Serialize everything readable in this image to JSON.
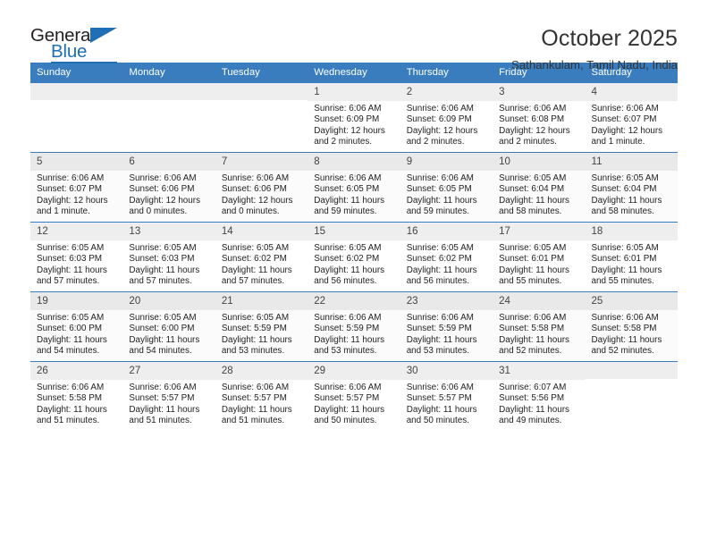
{
  "brand": {
    "name_part1": "General",
    "name_part2": "Blue"
  },
  "header": {
    "title": "October 2025",
    "location": "Sathankulam, Tamil Nadu, India"
  },
  "theme": {
    "accent": "#3a7dbf",
    "logo_blue": "#1f6fb4",
    "daynum_bg": "#eeeeee",
    "alt_row_bg": "#fbfbfb"
  },
  "weekday_headers": [
    "Sunday",
    "Monday",
    "Tuesday",
    "Wednesday",
    "Thursday",
    "Friday",
    "Saturday"
  ],
  "labels": {
    "sunrise_prefix": "Sunrise:",
    "sunset_prefix": "Sunset:",
    "daylight_prefix": "Daylight:"
  },
  "weeks": [
    [
      {
        "day": "",
        "empty": true,
        "line1": "",
        "line2": "",
        "line3": "",
        "line4": ""
      },
      {
        "day": "",
        "empty": true,
        "line1": "",
        "line2": "",
        "line3": "",
        "line4": ""
      },
      {
        "day": "",
        "empty": true,
        "line1": "",
        "line2": "",
        "line3": "",
        "line4": ""
      },
      {
        "day": "1",
        "empty": false,
        "line1": "Sunrise: 6:06 AM",
        "line2": "Sunset: 6:09 PM",
        "line3": "Daylight: 12 hours",
        "line4": "and 2 minutes."
      },
      {
        "day": "2",
        "empty": false,
        "line1": "Sunrise: 6:06 AM",
        "line2": "Sunset: 6:09 PM",
        "line3": "Daylight: 12 hours",
        "line4": "and 2 minutes."
      },
      {
        "day": "3",
        "empty": false,
        "line1": "Sunrise: 6:06 AM",
        "line2": "Sunset: 6:08 PM",
        "line3": "Daylight: 12 hours",
        "line4": "and 2 minutes."
      },
      {
        "day": "4",
        "empty": false,
        "line1": "Sunrise: 6:06 AM",
        "line2": "Sunset: 6:07 PM",
        "line3": "Daylight: 12 hours",
        "line4": "and 1 minute."
      }
    ],
    [
      {
        "day": "5",
        "empty": false,
        "line1": "Sunrise: 6:06 AM",
        "line2": "Sunset: 6:07 PM",
        "line3": "Daylight: 12 hours",
        "line4": "and 1 minute."
      },
      {
        "day": "6",
        "empty": false,
        "line1": "Sunrise: 6:06 AM",
        "line2": "Sunset: 6:06 PM",
        "line3": "Daylight: 12 hours",
        "line4": "and 0 minutes."
      },
      {
        "day": "7",
        "empty": false,
        "line1": "Sunrise: 6:06 AM",
        "line2": "Sunset: 6:06 PM",
        "line3": "Daylight: 12 hours",
        "line4": "and 0 minutes."
      },
      {
        "day": "8",
        "empty": false,
        "line1": "Sunrise: 6:06 AM",
        "line2": "Sunset: 6:05 PM",
        "line3": "Daylight: 11 hours",
        "line4": "and 59 minutes."
      },
      {
        "day": "9",
        "empty": false,
        "line1": "Sunrise: 6:06 AM",
        "line2": "Sunset: 6:05 PM",
        "line3": "Daylight: 11 hours",
        "line4": "and 59 minutes."
      },
      {
        "day": "10",
        "empty": false,
        "line1": "Sunrise: 6:05 AM",
        "line2": "Sunset: 6:04 PM",
        "line3": "Daylight: 11 hours",
        "line4": "and 58 minutes."
      },
      {
        "day": "11",
        "empty": false,
        "line1": "Sunrise: 6:05 AM",
        "line2": "Sunset: 6:04 PM",
        "line3": "Daylight: 11 hours",
        "line4": "and 58 minutes."
      }
    ],
    [
      {
        "day": "12",
        "empty": false,
        "line1": "Sunrise: 6:05 AM",
        "line2": "Sunset: 6:03 PM",
        "line3": "Daylight: 11 hours",
        "line4": "and 57 minutes."
      },
      {
        "day": "13",
        "empty": false,
        "line1": "Sunrise: 6:05 AM",
        "line2": "Sunset: 6:03 PM",
        "line3": "Daylight: 11 hours",
        "line4": "and 57 minutes."
      },
      {
        "day": "14",
        "empty": false,
        "line1": "Sunrise: 6:05 AM",
        "line2": "Sunset: 6:02 PM",
        "line3": "Daylight: 11 hours",
        "line4": "and 57 minutes."
      },
      {
        "day": "15",
        "empty": false,
        "line1": "Sunrise: 6:05 AM",
        "line2": "Sunset: 6:02 PM",
        "line3": "Daylight: 11 hours",
        "line4": "and 56 minutes."
      },
      {
        "day": "16",
        "empty": false,
        "line1": "Sunrise: 6:05 AM",
        "line2": "Sunset: 6:02 PM",
        "line3": "Daylight: 11 hours",
        "line4": "and 56 minutes."
      },
      {
        "day": "17",
        "empty": false,
        "line1": "Sunrise: 6:05 AM",
        "line2": "Sunset: 6:01 PM",
        "line3": "Daylight: 11 hours",
        "line4": "and 55 minutes."
      },
      {
        "day": "18",
        "empty": false,
        "line1": "Sunrise: 6:05 AM",
        "line2": "Sunset: 6:01 PM",
        "line3": "Daylight: 11 hours",
        "line4": "and 55 minutes."
      }
    ],
    [
      {
        "day": "19",
        "empty": false,
        "line1": "Sunrise: 6:05 AM",
        "line2": "Sunset: 6:00 PM",
        "line3": "Daylight: 11 hours",
        "line4": "and 54 minutes."
      },
      {
        "day": "20",
        "empty": false,
        "line1": "Sunrise: 6:05 AM",
        "line2": "Sunset: 6:00 PM",
        "line3": "Daylight: 11 hours",
        "line4": "and 54 minutes."
      },
      {
        "day": "21",
        "empty": false,
        "line1": "Sunrise: 6:05 AM",
        "line2": "Sunset: 5:59 PM",
        "line3": "Daylight: 11 hours",
        "line4": "and 53 minutes."
      },
      {
        "day": "22",
        "empty": false,
        "line1": "Sunrise: 6:06 AM",
        "line2": "Sunset: 5:59 PM",
        "line3": "Daylight: 11 hours",
        "line4": "and 53 minutes."
      },
      {
        "day": "23",
        "empty": false,
        "line1": "Sunrise: 6:06 AM",
        "line2": "Sunset: 5:59 PM",
        "line3": "Daylight: 11 hours",
        "line4": "and 53 minutes."
      },
      {
        "day": "24",
        "empty": false,
        "line1": "Sunrise: 6:06 AM",
        "line2": "Sunset: 5:58 PM",
        "line3": "Daylight: 11 hours",
        "line4": "and 52 minutes."
      },
      {
        "day": "25",
        "empty": false,
        "line1": "Sunrise: 6:06 AM",
        "line2": "Sunset: 5:58 PM",
        "line3": "Daylight: 11 hours",
        "line4": "and 52 minutes."
      }
    ],
    [
      {
        "day": "26",
        "empty": false,
        "line1": "Sunrise: 6:06 AM",
        "line2": "Sunset: 5:58 PM",
        "line3": "Daylight: 11 hours",
        "line4": "and 51 minutes."
      },
      {
        "day": "27",
        "empty": false,
        "line1": "Sunrise: 6:06 AM",
        "line2": "Sunset: 5:57 PM",
        "line3": "Daylight: 11 hours",
        "line4": "and 51 minutes."
      },
      {
        "day": "28",
        "empty": false,
        "line1": "Sunrise: 6:06 AM",
        "line2": "Sunset: 5:57 PM",
        "line3": "Daylight: 11 hours",
        "line4": "and 51 minutes."
      },
      {
        "day": "29",
        "empty": false,
        "line1": "Sunrise: 6:06 AM",
        "line2": "Sunset: 5:57 PM",
        "line3": "Daylight: 11 hours",
        "line4": "and 50 minutes."
      },
      {
        "day": "30",
        "empty": false,
        "line1": "Sunrise: 6:06 AM",
        "line2": "Sunset: 5:57 PM",
        "line3": "Daylight: 11 hours",
        "line4": "and 50 minutes."
      },
      {
        "day": "31",
        "empty": false,
        "line1": "Sunrise: 6:07 AM",
        "line2": "Sunset: 5:56 PM",
        "line3": "Daylight: 11 hours",
        "line4": "and 49 minutes."
      },
      {
        "day": "",
        "empty": true,
        "line1": "",
        "line2": "",
        "line3": "",
        "line4": ""
      }
    ]
  ]
}
